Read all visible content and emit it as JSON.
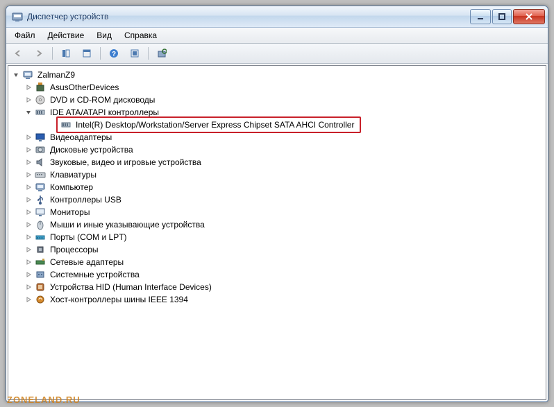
{
  "window": {
    "title": "Диспетчер устройств"
  },
  "menu": {
    "file": "Файл",
    "action": "Действие",
    "view": "Вид",
    "help": "Справка"
  },
  "tree": {
    "root": "ZalmanZ9",
    "items": [
      {
        "label": "AsusOtherDevices",
        "icon": "generic"
      },
      {
        "label": "DVD и CD-ROM дисководы",
        "icon": "disc"
      },
      {
        "label": "IDE ATA/ATAPI контроллеры",
        "icon": "ide",
        "expanded": true,
        "child": {
          "label": "Intel(R) Desktop/Workstation/Server Express Chipset SATA AHCI Controller",
          "icon": "ide"
        }
      },
      {
        "label": "Видеоадаптеры",
        "icon": "display"
      },
      {
        "label": "Дисковые устройства",
        "icon": "hdd"
      },
      {
        "label": "Звуковые, видео и игровые устройства",
        "icon": "sound"
      },
      {
        "label": "Клавиатуры",
        "icon": "keyboard"
      },
      {
        "label": "Компьютер",
        "icon": "computer"
      },
      {
        "label": "Контроллеры USB",
        "icon": "usb"
      },
      {
        "label": "Мониторы",
        "icon": "monitor"
      },
      {
        "label": "Мыши и иные указывающие устройства",
        "icon": "mouse"
      },
      {
        "label": "Порты (COM и LPT)",
        "icon": "port"
      },
      {
        "label": "Процессоры",
        "icon": "cpu"
      },
      {
        "label": "Сетевые адаптеры",
        "icon": "network"
      },
      {
        "label": "Системные устройства",
        "icon": "system"
      },
      {
        "label": "Устройства HID (Human Interface Devices)",
        "icon": "hid"
      },
      {
        "label": "Хост-контроллеры шины IEEE 1394",
        "icon": "firewire"
      }
    ]
  },
  "watermark": "ZONELAND.RU"
}
